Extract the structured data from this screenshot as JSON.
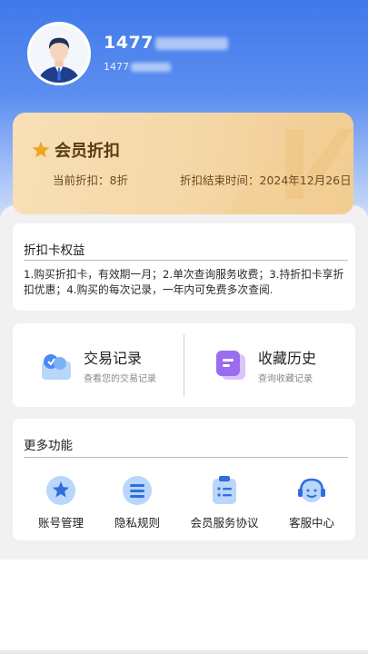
{
  "colors": {
    "header_blue": "#3f79ea",
    "vip_gold": "#f5d7a6",
    "vip_text": "#5a3a12",
    "icon_blue": "#4a8af0",
    "icon_purple": "#9b6bf0"
  },
  "user": {
    "name": "1477",
    "phone": "1477",
    "avatar_icon": "user-avatar"
  },
  "vip": {
    "star_icon": "star-icon",
    "title": "会员折扣",
    "current_discount": "当前折扣：8折",
    "end_time": "折扣结束时间：2024年12月26日"
  },
  "benefits": {
    "heading": "折扣卡权益",
    "text": "1.购买折扣卡，有效期一月；2.单次查询服务收费；3.持折扣卡享折扣优惠；4.购买的每次记录，一年内可免费多次查阅."
  },
  "records": {
    "transactions": {
      "title": "交易记录",
      "subtitle": "查看您的交易记录",
      "icon": "transaction-icon"
    },
    "favorites": {
      "title": "收藏历史",
      "subtitle": "查询收藏记录",
      "icon": "favorites-icon"
    }
  },
  "more": {
    "heading": "更多功能",
    "items": [
      {
        "label": "账号管理",
        "icon": "star-icon"
      },
      {
        "label": "隐私规则",
        "icon": "list-icon"
      },
      {
        "label": "会员服务协议",
        "icon": "clipboard-icon"
      },
      {
        "label": "客服中心",
        "icon": "headset-icon"
      }
    ]
  }
}
